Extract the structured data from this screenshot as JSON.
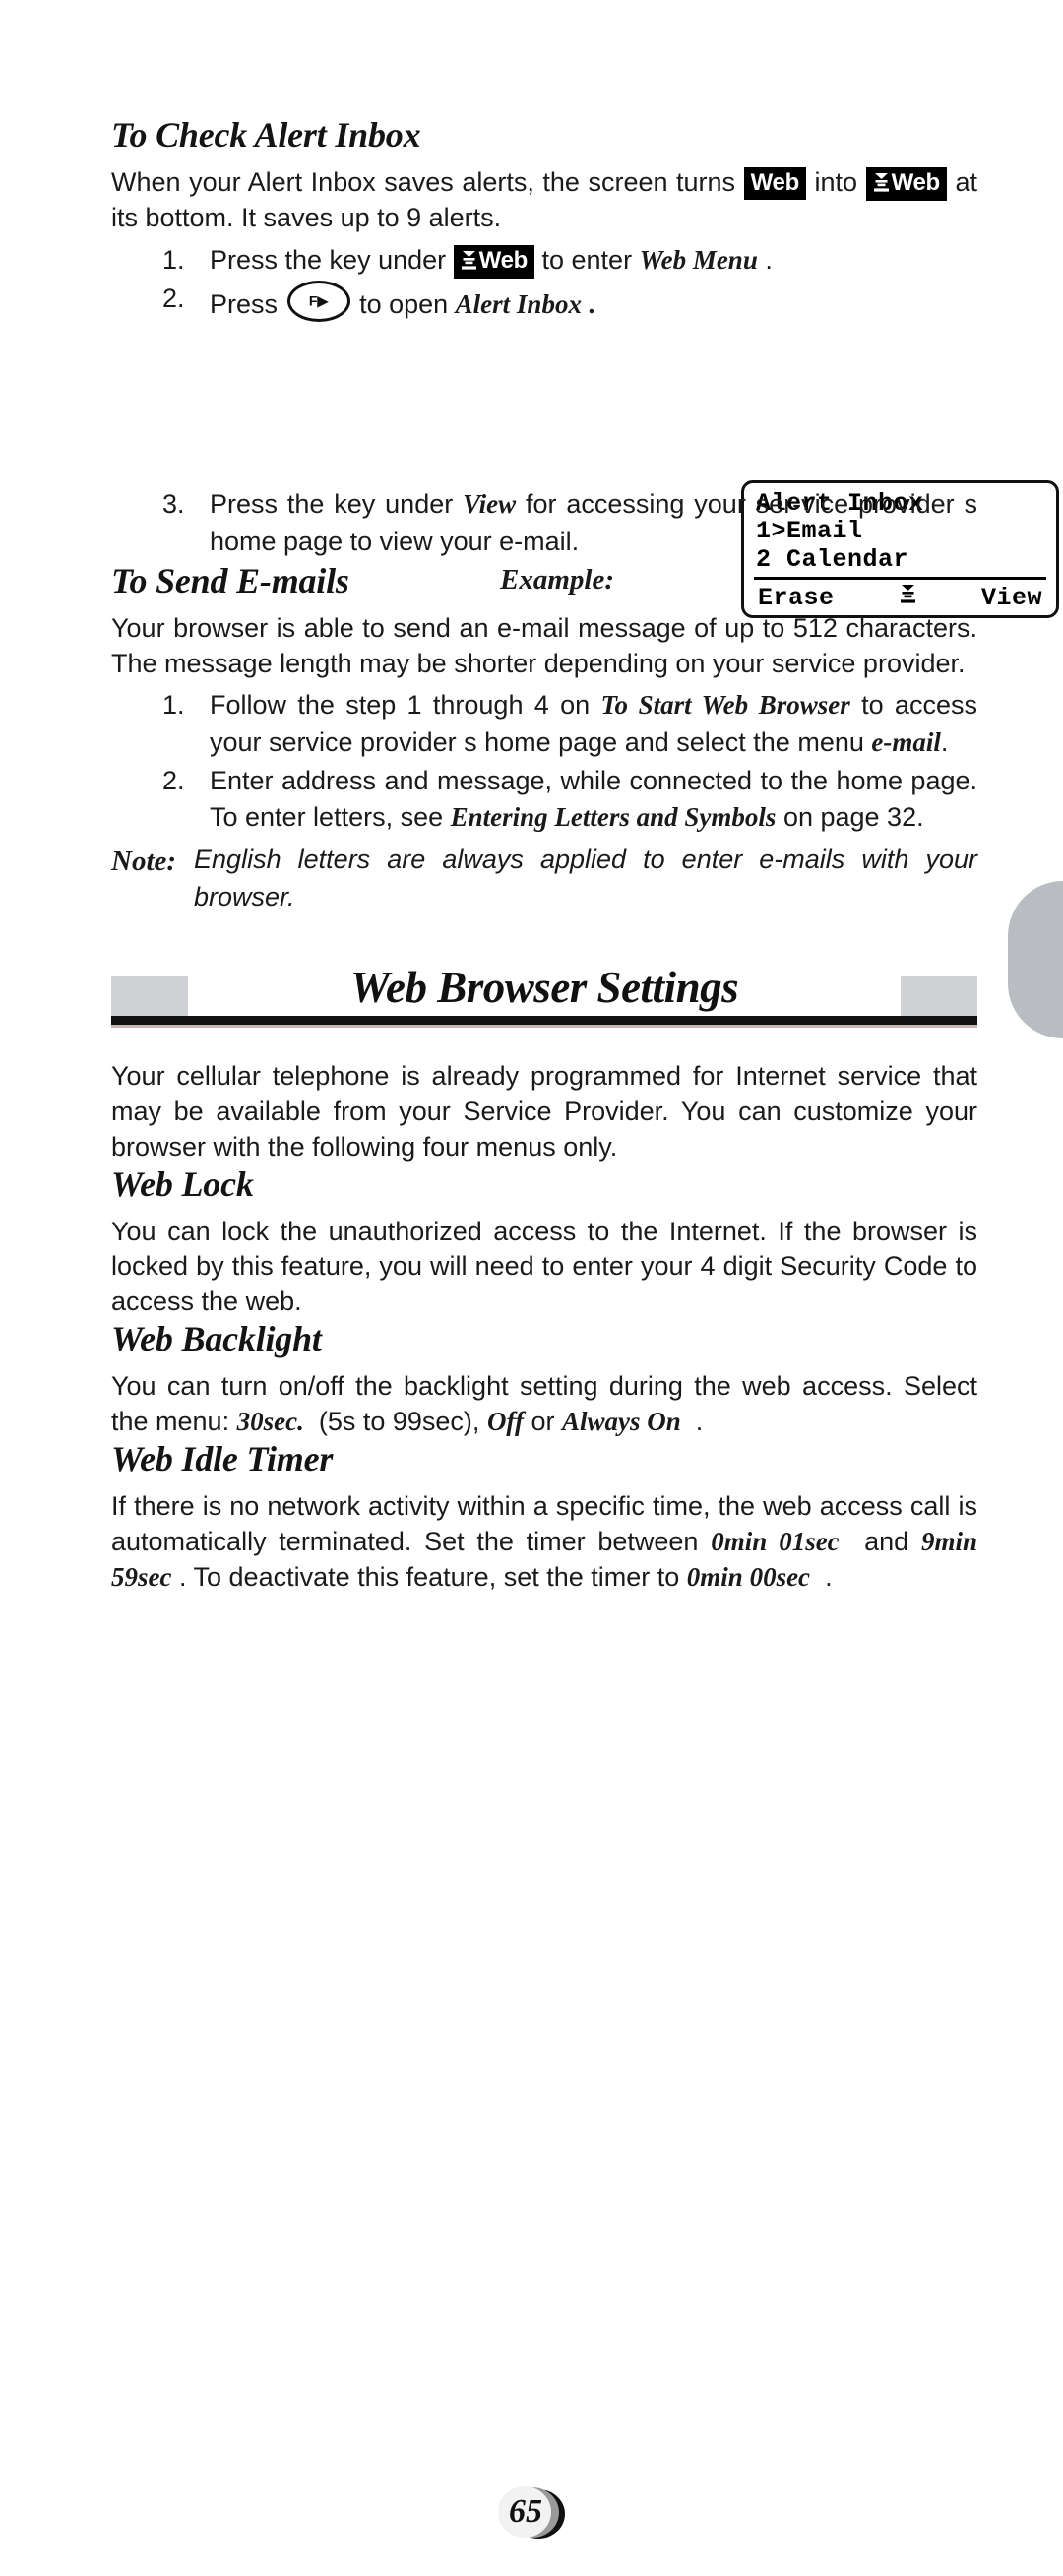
{
  "page": {
    "number": "65"
  },
  "sections": {
    "check_alert_inbox": {
      "heading": "To Check Alert Inbox",
      "intro_part1": "When your Alert Inbox saves alerts, the screen turns",
      "badge_plain": "Web",
      "intro_mid": "into",
      "badge_mail": "Web",
      "intro_part2": "at its bottom. It saves up to 9 alerts.",
      "steps": [
        {
          "num": "1.",
          "text_before": "Press the key under",
          "badge": "Web",
          "text_after": "to enter",
          "emphasis": "Web Menu",
          "text_end": "."
        },
        {
          "num": "2.",
          "text_before": "Press",
          "key_glyph": "F",
          "text_after": "to open",
          "emphasis": "Alert Inbox",
          "text_end": "."
        },
        {
          "num": "3.",
          "text_before": "Press the key under",
          "emphasis": "View",
          "text_after": "for accessing your ser-vice provider s home page to view your e-mail."
        }
      ],
      "example_label": "Example:",
      "lcd": {
        "title": "Alert Inbox",
        "item1": "1>Email",
        "item2": "2 Calendar",
        "softkey_left": "Erase",
        "softkey_right": "View"
      }
    },
    "send_emails": {
      "heading": "To Send E-mails",
      "paragraph": "Your browser is able to send an e-mail message of up to 512 characters. The message length may be shorter depending on your service provider.",
      "steps": [
        {
          "num": "1.",
          "t1": "Follow the step 1 through 4 on",
          "em1": "To Start Web Browser",
          "t2": "to access your service provider s home page and select the menu",
          "em2": "e-mail",
          "t3": "."
        },
        {
          "num": "2.",
          "t1": "Enter address and message, while connected to the home page. To enter letters, see",
          "em1": "Entering Letters and Symbols",
          "t2": "on page 32."
        }
      ],
      "note_label": "Note:",
      "note_text": "English letters are always applied to enter e-mails with your browser."
    },
    "web_browser_settings": {
      "banner_title": "Web Browser Settings",
      "intro": "Your cellular telephone is already programmed for Internet service that may be available from your Service Provider. You can customize your browser with the following four menus only.",
      "web_lock": {
        "heading": "Web Lock",
        "paragraph": "You can lock the unauthorized access to the Internet. If the browser is locked by this feature, you will need to enter your 4 digit Security Code to access the web."
      },
      "web_backlight": {
        "heading": "Web Backlight",
        "t1": "You can turn on/off the backlight setting during the web access. Select the menu:",
        "em1": "30sec.",
        "t2": "(5s to 99sec),",
        "em2": "Off",
        "t3": "or",
        "em3": "Always On",
        "t4": "."
      },
      "web_idle_timer": {
        "heading": "Web Idle Timer",
        "t1": "If there is no network activity within a specific time, the web access call is automatically terminated. Set the timer between",
        "em1": "0min 01sec",
        "t2": "and",
        "em2": "9min 59sec",
        "t3": ". To deactivate this feature, set the timer to",
        "em3": "0min 00sec",
        "t4": "."
      }
    }
  },
  "icons": {
    "mail_badge": "mail-stack-icon",
    "fn_key": "fn-right-arrow-key-icon"
  },
  "colors": {
    "badge_bg": "#000000",
    "badge_fg": "#ffffff",
    "banner_block": "#cfd1d4",
    "rule": "#111111",
    "edge_tab": "#b9bcc0"
  }
}
